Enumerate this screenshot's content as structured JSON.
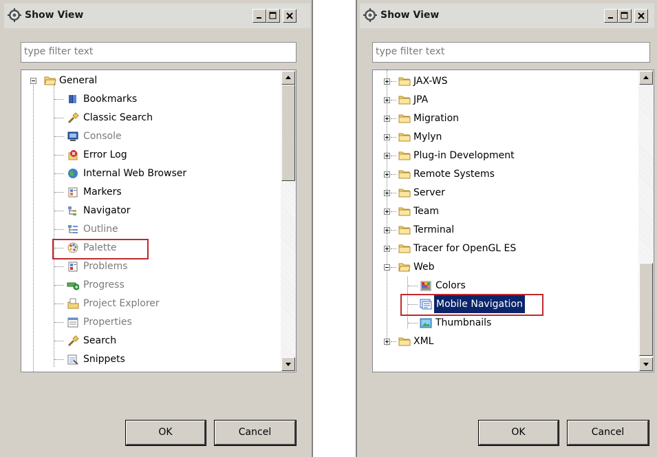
{
  "left_dialog": {
    "title": "Show View",
    "filter_placeholder": "type filter text",
    "tree": {
      "root": "General",
      "items": [
        {
          "label": "Bookmarks",
          "icon": "bookmarks-icon",
          "dim": false
        },
        {
          "label": "Classic Search",
          "icon": "search-flashlight-icon",
          "dim": false
        },
        {
          "label": "Console",
          "icon": "console-icon",
          "dim": true
        },
        {
          "label": "Error Log",
          "icon": "error-log-icon",
          "dim": false
        },
        {
          "label": "Internal Web Browser",
          "icon": "globe-icon",
          "dim": false
        },
        {
          "label": "Markers",
          "icon": "markers-icon",
          "dim": false
        },
        {
          "label": "Navigator",
          "icon": "navigator-icon",
          "dim": false
        },
        {
          "label": "Outline",
          "icon": "outline-icon",
          "dim": true
        },
        {
          "label": "Palette",
          "icon": "palette-icon",
          "dim": true
        },
        {
          "label": "Problems",
          "icon": "problems-icon",
          "dim": true
        },
        {
          "label": "Progress",
          "icon": "progress-icon",
          "dim": true
        },
        {
          "label": "Project Explorer",
          "icon": "project-explorer-icon",
          "dim": true
        },
        {
          "label": "Properties",
          "icon": "properties-icon",
          "dim": true
        },
        {
          "label": "Search",
          "icon": "search-flashlight-icon",
          "dim": false
        },
        {
          "label": "Snippets",
          "icon": "snippets-icon",
          "dim": false
        }
      ],
      "highlighted": "Palette"
    },
    "ok_label": "OK",
    "cancel_label": "Cancel"
  },
  "right_dialog": {
    "title": "Show View",
    "filter_placeholder": "type filter text",
    "tree": {
      "folders_before": [
        "JAX-WS",
        "JPA",
        "Migration",
        "Mylyn",
        "Plug-in Development",
        "Remote Systems",
        "Server",
        "Team",
        "Terminal",
        "Tracer for OpenGL ES"
      ],
      "expanded_folder": "Web",
      "web_items": [
        {
          "label": "Colors",
          "icon": "colors-icon"
        },
        {
          "label": "Mobile Navigation",
          "icon": "mobile-navigation-icon"
        },
        {
          "label": "Thumbnails",
          "icon": "thumbnails-icon"
        }
      ],
      "folders_after": [
        "XML"
      ],
      "selected": "Mobile Navigation"
    },
    "ok_label": "OK",
    "cancel_label": "Cancel"
  },
  "colors": {
    "highlight_border": "#c0282d",
    "selection_bg": "#0a246a",
    "dialog_bg": "#d4d0c8"
  }
}
